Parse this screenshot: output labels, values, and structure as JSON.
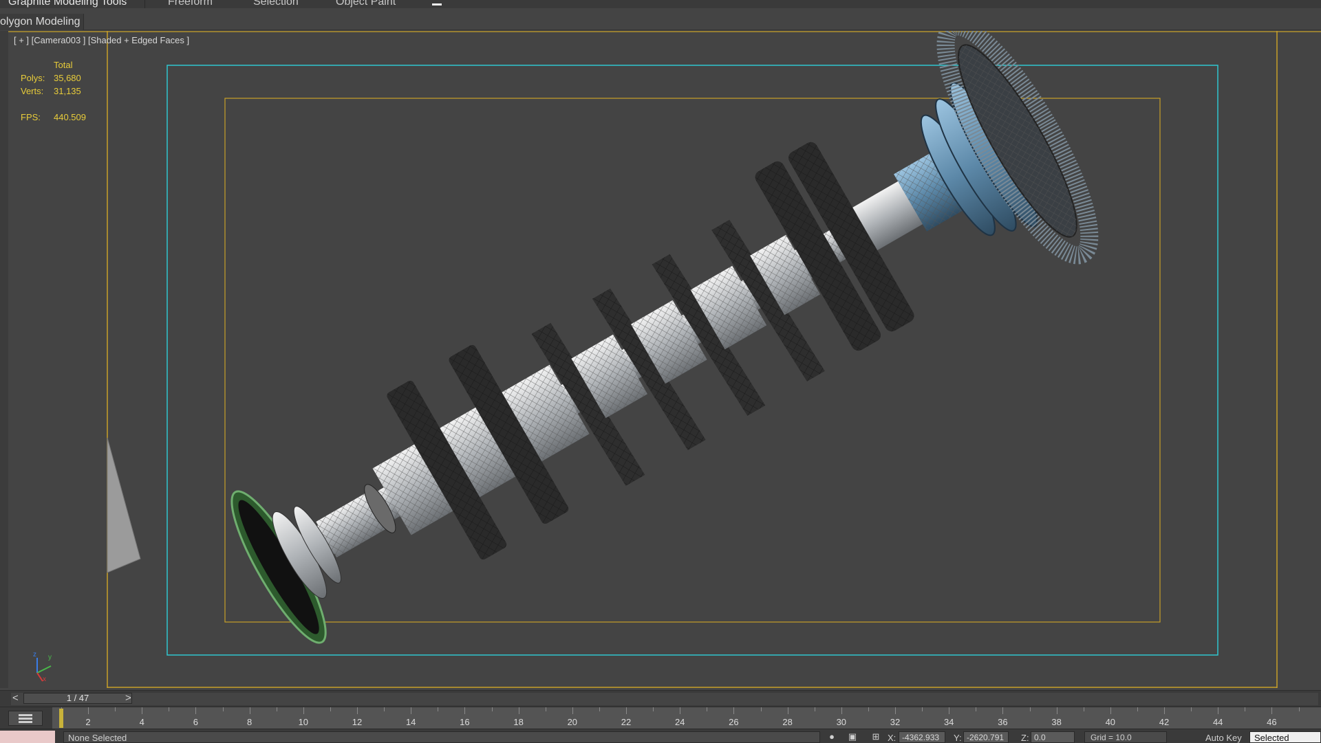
{
  "ribbon": {
    "tabs": [
      {
        "label": "Graphite Modeling Tools",
        "active": true
      },
      {
        "label": "Freeform",
        "active": false
      },
      {
        "label": "Selection",
        "active": false
      },
      {
        "label": "Object Paint",
        "active": false
      }
    ]
  },
  "panel": {
    "title": "olygon Modeling"
  },
  "viewport": {
    "label": "[ + ] [Camera003 ] [Shaded + Edged Faces ]",
    "stats": {
      "header": "Total",
      "polys_label": "Polys:",
      "polys_value": "35,680",
      "verts_label": "Verts:",
      "verts_value": "31,135",
      "fps_label": "FPS:",
      "fps_value": "440.509"
    },
    "gizmo": {
      "x": "x",
      "y": "y",
      "z": "z"
    },
    "colors": {
      "safe_frame_outer": "#c8a028",
      "safe_frame_action": "#2fc7d0",
      "background": "#444444"
    }
  },
  "time_slider": {
    "position": "1 / 47",
    "prev_arrow": "<",
    "next_arrow": ">",
    "current_frame": 1,
    "total_frames": 47
  },
  "trackbar": {
    "labels": [
      "2",
      "4",
      "6",
      "8",
      "10",
      "12",
      "14",
      "16",
      "18",
      "20",
      "22",
      "24",
      "26",
      "28",
      "30",
      "32",
      "34",
      "36",
      "38",
      "40",
      "42",
      "44",
      "46"
    ]
  },
  "status": {
    "selection": "None Selected",
    "x_label": "X:",
    "x_value": "-4362.933",
    "y_label": "Y:",
    "y_value": "-2620.791",
    "z_label": "Z:",
    "z_value": "0.0",
    "grid": "Grid = 10.0",
    "auto_key": "Auto Key",
    "key_mode": "Selected"
  }
}
